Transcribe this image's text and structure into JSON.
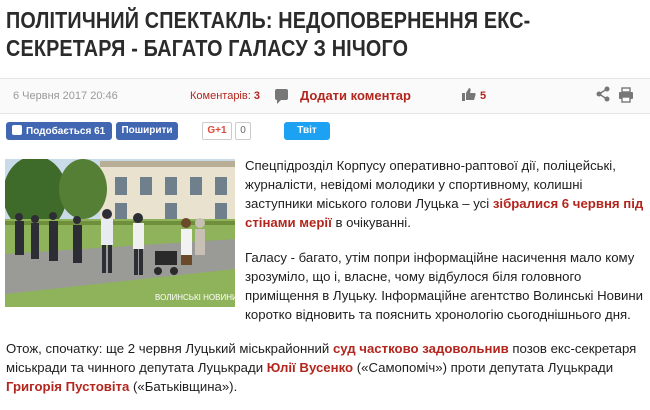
{
  "article": {
    "title": "ПОЛІТИЧНИЙ СПЕКТАКЛЬ: НЕДОПОВЕРНЕННЯ ЕКС-СЕКРЕТАРЯ - БАГАТО ГАЛАСУ З НІЧОГО"
  },
  "meta": {
    "date": "6 Червня 2017 20:46",
    "comments_label": "Коментарів:",
    "comments_count": "3",
    "add_comment_label": "Додати коментар",
    "likes_count": "5",
    "icons": [
      "comment-icon",
      "thumbs-up-icon",
      "share-icon",
      "print-icon"
    ]
  },
  "social": {
    "fb_like_label": "Подобається 61",
    "fb_share_label": "Поширити",
    "gplus_label": "G+1",
    "gplus_count": "0",
    "tweet_label": "Твіт"
  },
  "photo": {
    "watermark": "ВОЛИНСЬКІ НОВИНИ"
  },
  "body": {
    "p1": {
      "t1": "Спецпідрозділ Корпусу оперативно-раптової дії, поліцейські, журналісти, невідомі молодики у спортивному, колишні заступники міського голови Луцька – усі ",
      "link": "зібралися 6 червня під стінами мерії",
      "t2": " в очікуванні."
    },
    "p2": {
      "text": "Галасу - багато, утім попри інформаційне насичення мало кому зрозуміло, що і, власне, чому відбулося біля головного приміщення в Луцьку. Інформаційне агентство Волинські Новини коротко відновить та пояснить хронологію сьогоднішнього дня."
    },
    "p3": {
      "t1": "Отож, спочатку: ще 2 червня Луцький міськрайонний ",
      "link1": "суд частково задовольнив",
      "t2": " позов екс-секретаря міськради та чинного депутата Луцькради ",
      "link2": "Юлії Вусенко",
      "t3": " («Самопоміч») проти депутата Луцькради ",
      "link3": "Григорія Пустовіта",
      "t4": " («Батьківщина»)."
    }
  },
  "colors": {
    "accent": "#b3261e",
    "facebook": "#4267b2",
    "twitter": "#1da1f2"
  }
}
